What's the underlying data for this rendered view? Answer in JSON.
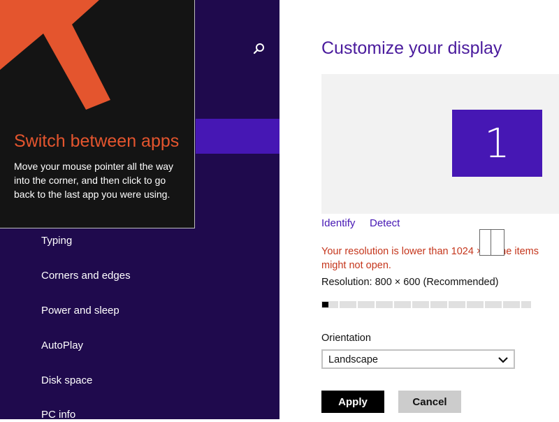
{
  "tooltip": {
    "title": "Switch between apps",
    "body": "Move your mouse pointer all the way into the corner, and then click to go back to the last app you were using."
  },
  "sidebar": {
    "items": [
      {
        "label": "Typing"
      },
      {
        "label": "Corners and edges"
      },
      {
        "label": "Power and sleep"
      },
      {
        "label": "AutoPlay"
      },
      {
        "label": "Disk space"
      },
      {
        "label": "PC info"
      }
    ]
  },
  "main": {
    "title": "Customize your display",
    "monitor_label": "1",
    "identify_link": "Identify",
    "detect_link": "Detect",
    "warning_line1": "Your resolution is lower than 1024 ×      Some items",
    "warning_line2": "might not open.",
    "resolution_label": "Resolution: 800 × 600 (Recommended)",
    "resolution_slider_value": 0,
    "orientation_label": "Orientation",
    "orientation_value": "Landscape",
    "apply_label": "Apply",
    "cancel_label": "Cancel"
  },
  "colors": {
    "sidebar_bg": "#1f0a4d",
    "accent": "#4617b4",
    "tooltip_bg": "#141414",
    "tooltip_accent": "#e4552e",
    "warning": "#c5361c"
  },
  "icons": {
    "search": "search-icon",
    "corner_arrow": "arrow-icon",
    "chevron": "chevron-down-icon"
  }
}
